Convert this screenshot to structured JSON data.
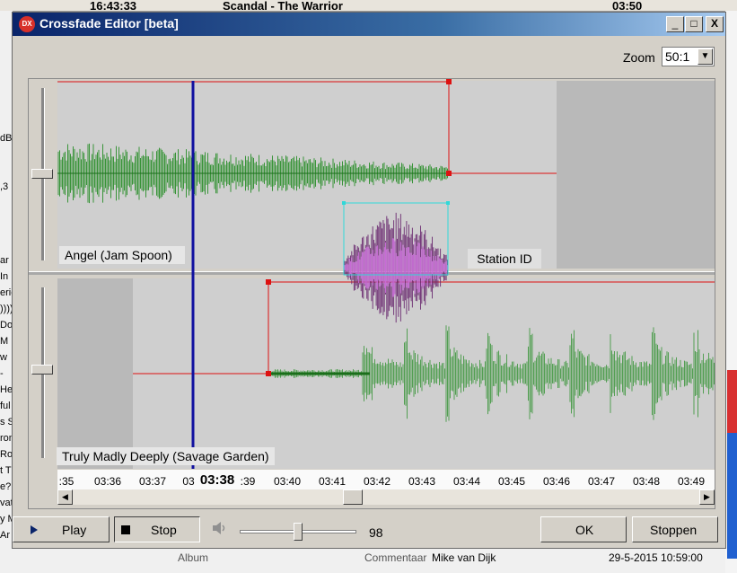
{
  "background": {
    "top_time": "16:43:33",
    "top_title": "Scandal - The Warrior",
    "top_length": "03:50",
    "left_fragments": [
      "dB",
      ",3",
      "ar",
      "In",
      "eric",
      "))))",
      "Do",
      "M",
      "w",
      "-",
      "He",
      "ful",
      "s S",
      "ron",
      "Ro",
      "t T",
      "e?",
      "vat",
      "y M",
      "Ar"
    ],
    "bottom_album": "Album",
    "bottom_comment": "Commentaar",
    "bottom_name": "Mike van Dijk",
    "bottom_stamp": "29-5-2015 10:59:00"
  },
  "window": {
    "title": "Crossfade Editor [beta]",
    "icon_text": "DX",
    "minimize": "_",
    "maximize": "□",
    "close": "X"
  },
  "zoom": {
    "label": "Zoom",
    "value": "50:1"
  },
  "tracks": {
    "top": "Angel (Jam  Spoon)",
    "bottom": "Truly Madly Deeply (Savage Garden)",
    "insert": "Station ID"
  },
  "timeline": {
    "ticks": [
      ":35",
      "03:36",
      "03:37",
      "03",
      "03:38",
      ":39",
      "03:40",
      "03:41",
      "03:42",
      "03:43",
      "03:44",
      "03:45",
      "03:46",
      "03:47",
      "03:48",
      "03:49"
    ],
    "current": "03:38"
  },
  "controls": {
    "play": "Play",
    "stop": "Stop",
    "volume": "98",
    "ok": "OK",
    "stoppen": "Stoppen"
  },
  "colors": {
    "track_wave": "#1e8a1e",
    "insert_wave": "#d070e0",
    "fade_line": "#dd1111",
    "cursor": "#1010a0"
  }
}
